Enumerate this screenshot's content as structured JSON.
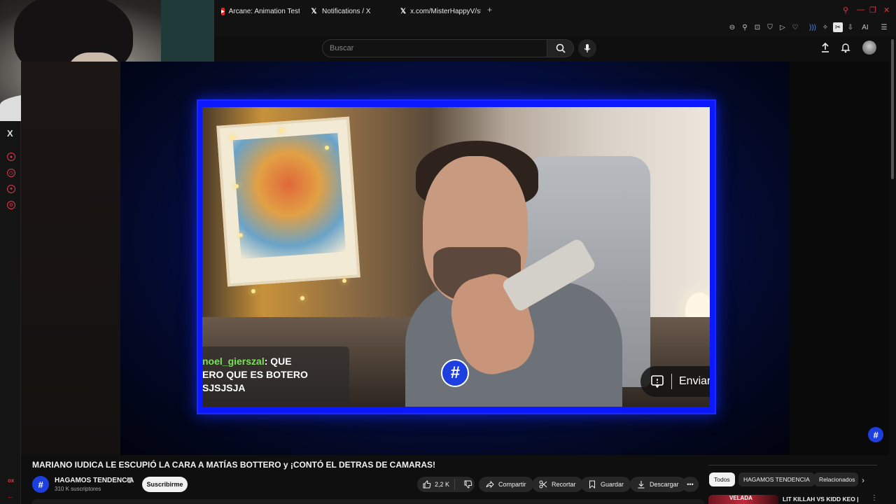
{
  "browser": {
    "tabs": [
      {
        "label": "Arcane: Animation Test - ",
        "favicon": "youtube-icon"
      },
      {
        "label": "Notifications / X",
        "favicon": "x-icon"
      },
      {
        "label": "x.com/MisterHappyV/statu",
        "favicon": "x-icon"
      }
    ],
    "new_tab": "+",
    "ai_label": "AI",
    "accent_color": "#e0364b"
  },
  "sidebar": {
    "x_label": "X",
    "bottom_a": "ox",
    "bottom_b": "..."
  },
  "youtube": {
    "search_placeholder": "Buscar"
  },
  "video_overlay": {
    "chat_user": "noel_gierszal",
    "chat_sep": ": QUE",
    "chat_line2": "ERO QUE ES BOTERO",
    "chat_line3": "SJSJSJA",
    "send_label": "Enviar",
    "logo_glyph": "#"
  },
  "video": {
    "title": "MARIANO IUDICA LE ESCUPIÓ LA CARA A MATÍAS BOTTERO y ¡CONTÓ EL DETRAS DE CAMARAS!",
    "channel": "HAGAMOS TENDENCIA",
    "subscribers": "310 K suscriptores",
    "subscribe_label": "Suscribirme",
    "likes": "2,2 K",
    "share_label": "Compartir",
    "clip_label": "Recortar",
    "save_label": "Guardar",
    "download_label": "Descargar",
    "more_label": "•••"
  },
  "chips": [
    "Todos",
    "HAGAMOS TENDENCIA",
    "Relacionados"
  ],
  "related": {
    "title": "LIT KILLAH VS KIDD KEO |",
    "thumb_text": "VELADA"
  }
}
